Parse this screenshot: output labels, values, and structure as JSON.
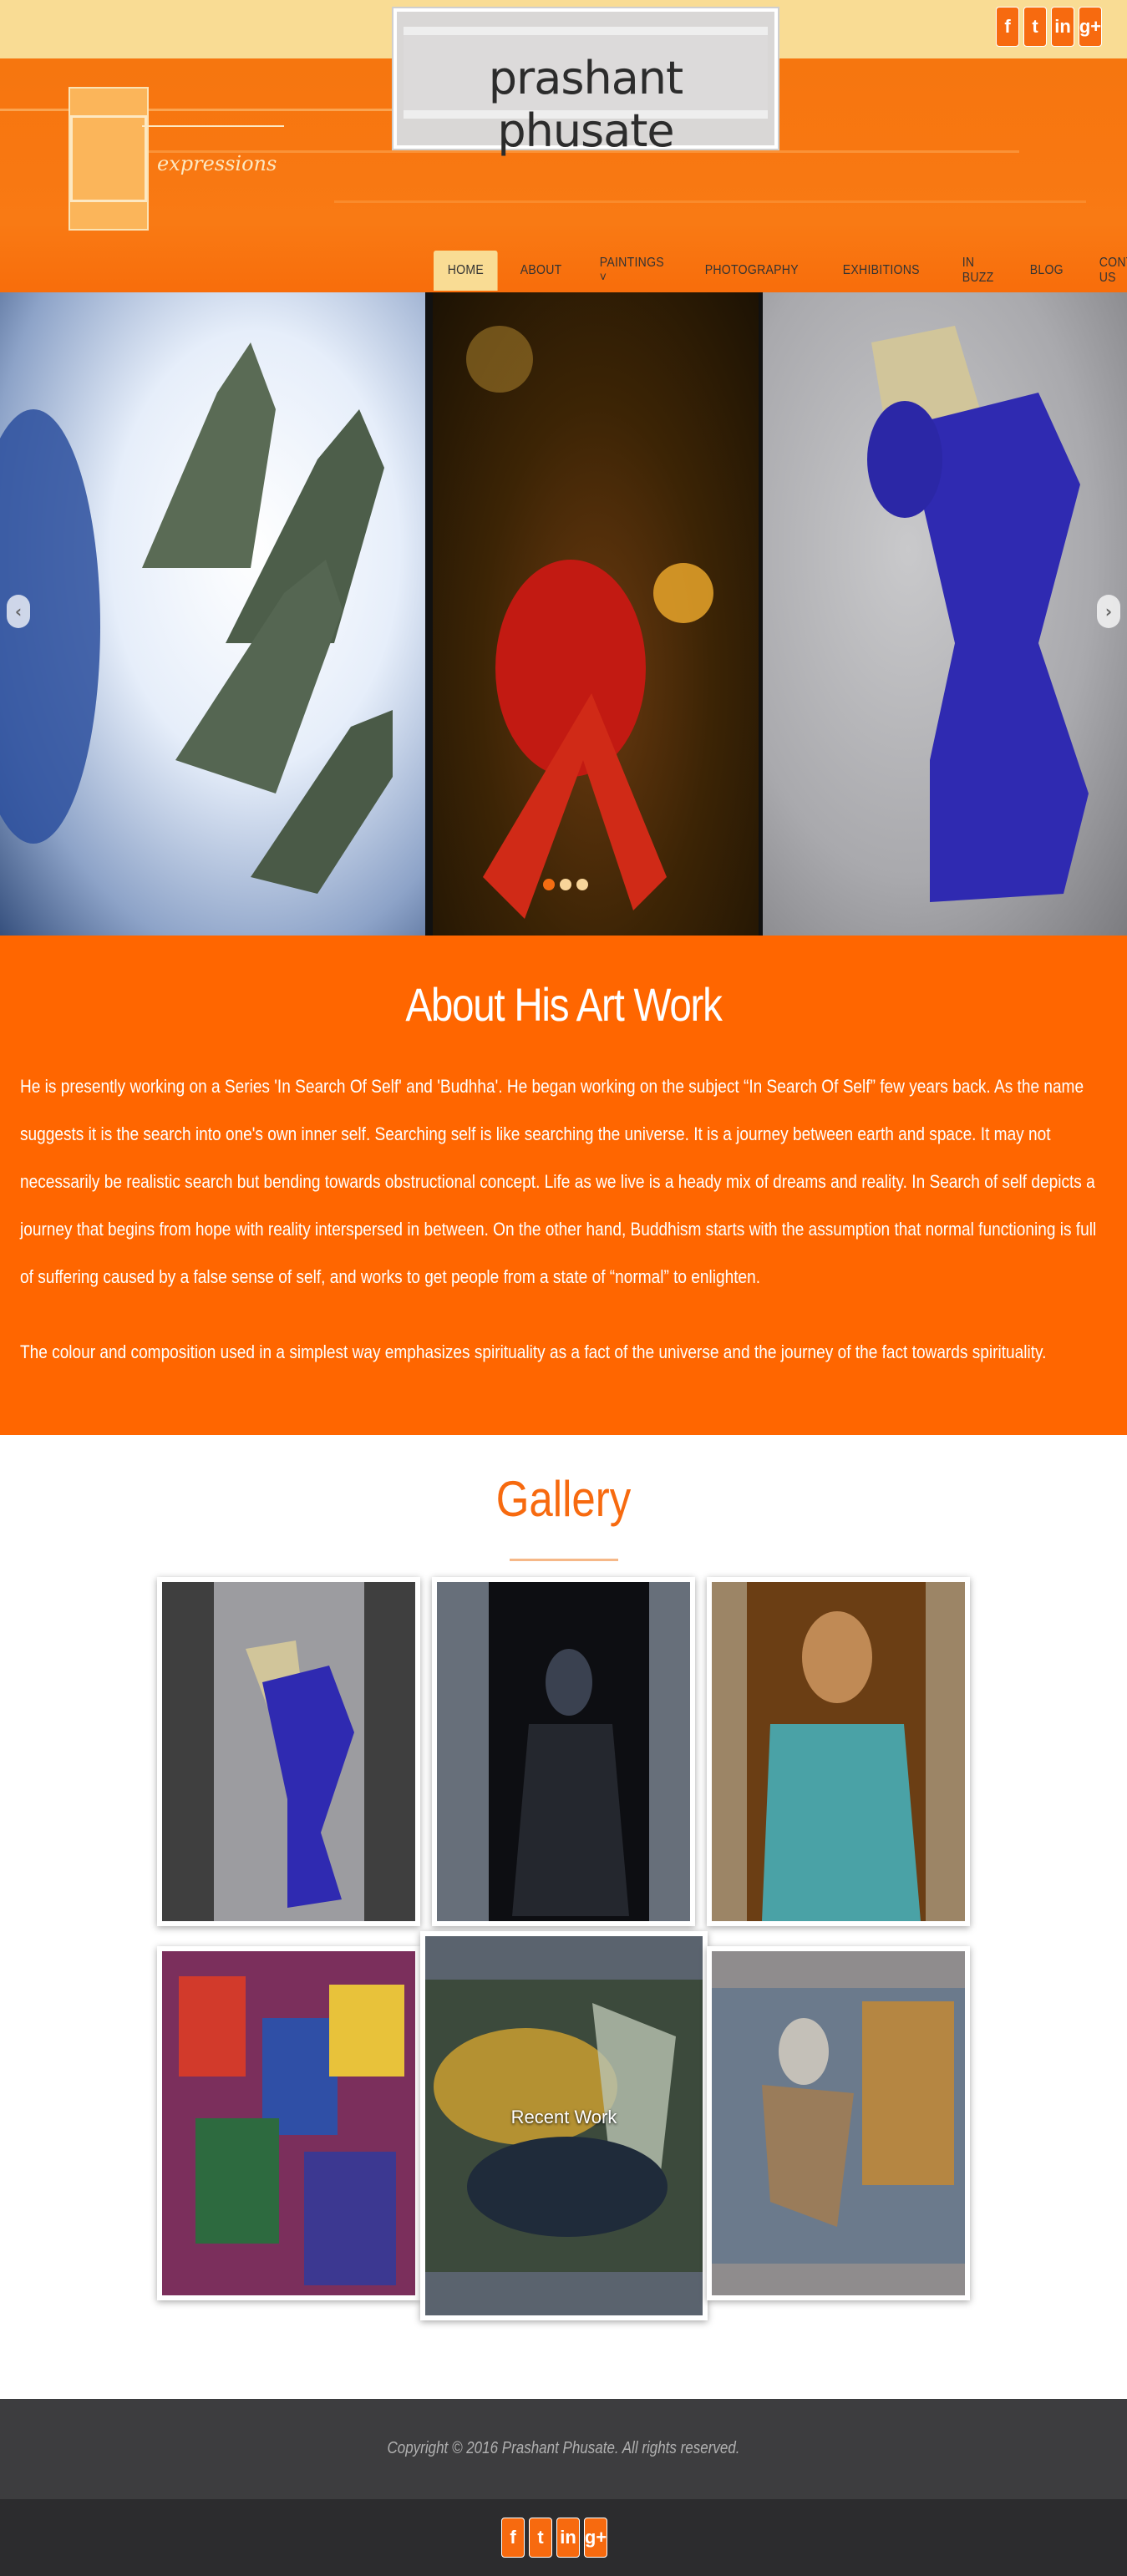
{
  "site": {
    "title": "prashant phusate",
    "logo_text": "expressions"
  },
  "social": [
    {
      "icon": "facebook-icon",
      "glyph": "f"
    },
    {
      "icon": "twitter-icon",
      "glyph": "t"
    },
    {
      "icon": "linkedin-icon",
      "glyph": "in"
    },
    {
      "icon": "google-plus-icon",
      "glyph": "g+"
    }
  ],
  "nav": {
    "items": [
      {
        "label": "HOME",
        "active": true
      },
      {
        "label": "ABOUT"
      },
      {
        "label": "PAINTINGS ˅"
      },
      {
        "label": "PHOTOGRAPHY"
      },
      {
        "label": "EXHIBITIONS"
      },
      {
        "label": "IN BUZZ"
      },
      {
        "label": "BLOG"
      },
      {
        "label": "CONTACT US"
      }
    ]
  },
  "slider": {
    "prev": "‹",
    "next": "›",
    "dots": 3,
    "active_dot": 0
  },
  "about": {
    "heading": "About His Art Work",
    "paragraph1": "He is presently working on a Series 'In Search Of Self' and 'Budhha'. He began working on the subject “In Search Of Self” few years back. As the name suggests it is the search into one's own inner self. Searching self is like searching the universe. It is a journey between earth and space. It may not necessarily be realistic search but bending towards obstructional concept. Life as we live is a heady mix of dreams and reality. In Search of self depicts a journey that begins from hope with reality interspersed in between. On the other hand, Buddhism starts with the assumption that normal functioning is full of suffering caused by a false sense of self, and works to get people from a state of “normal” to enlighten.",
    "paragraph2": "The colour and composition used in a simplest way emphasizes spirituality as a fact of the universe and the journey of the fact towards spirituality."
  },
  "gallery": {
    "title": "Gallery",
    "overlay_label": "Recent Work"
  },
  "footer": {
    "copyright": "Copyright © 2016 Prashant Phusate. All rights reserved."
  },
  "colors": {
    "accent": "#ff6600",
    "topbar": "#f9dc94",
    "footer_top": "#3d3d3f",
    "footer_bottom": "#2c2c2e"
  }
}
